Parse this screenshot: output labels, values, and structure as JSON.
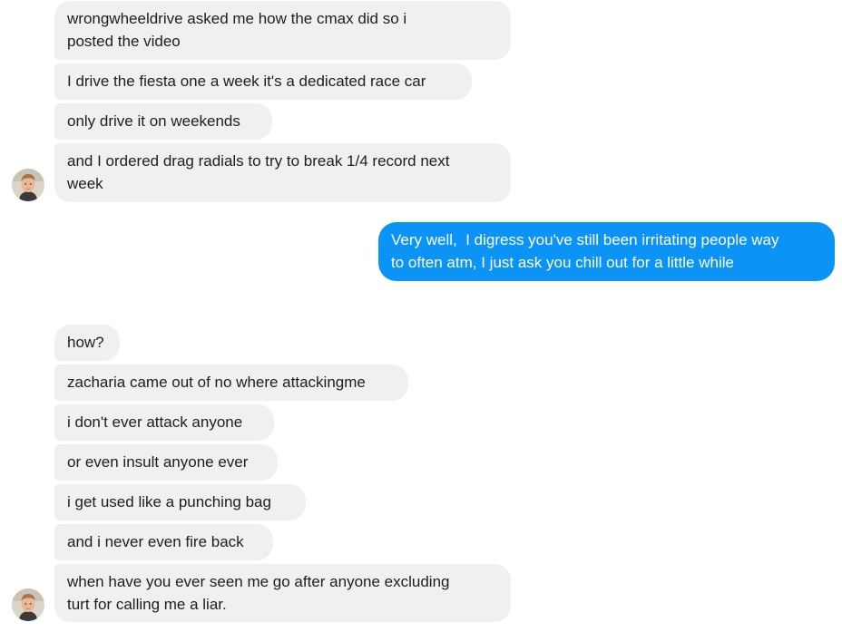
{
  "messages": {
    "group1": [
      "wrongwheeldrive asked me how the cmax did so i\nposted the video",
      "I drive the fiesta one a week it's a dedicated race car",
      "only drive it on weekends",
      "and I ordered drag radials to try to break 1/4 record next\nweek"
    ],
    "outgoing": "Very well,  I digress you've still been irritating people way\nto often atm, I just ask you chill out for a little while",
    "group2": [
      "how?",
      "zacharia came out of no where attackingme",
      "i don't ever attack anyone",
      "or even insult anyone ever",
      "i get used like a punching bag",
      "and i never even fire back",
      "when have you ever seen me go after anyone excluding\nturt for calling me a liar."
    ]
  },
  "colors": {
    "incoming_bubble": "#f0f0f0",
    "outgoing_bubble": "#0b93f6"
  },
  "icons": {
    "contact_avatar": "avatar"
  }
}
